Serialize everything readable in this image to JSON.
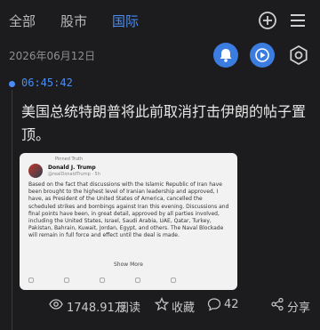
{
  "tabs": [
    {
      "label": "全部"
    },
    {
      "label": "股市"
    },
    {
      "label": "国际"
    }
  ],
  "active_tab": 2,
  "date": "2026年06月12日",
  "item": {
    "time": "06:45:42",
    "headline": "美国总统特朗普将此前取消打击伊朗的帖子置顶。",
    "embed": {
      "pinned_label": "Pinned Truth",
      "author_name": "Donald J. Trump",
      "author_handle": "@realDonaldTrump · 5h",
      "body": "Based on the fact that discussions with the Islamic Republic of Iran have been brought to the highest level of Iranian leadership and approved, I have, as President of the United States of America, cancelled the scheduled strikes and bombings against Iran this evening. Discussions and final points have been, in great detail, approved by all parties involved, including the United States, Israel, Saudi Arabia, UAE, Qatar, Turkey, Pakistan, Bahrain, Kuwait, Jordan, Egypt, and others. The Naval Blockade will remain in full force and effect until the deal is made.",
      "show_more": "Show More"
    },
    "stats": {
      "views": "1748.91万",
      "views_unit": "阅读",
      "favorite": "收藏",
      "comments": "42",
      "share": "分享"
    }
  },
  "colors": {
    "accent": "#4a8df5",
    "background": "#1c1c1e"
  },
  "icons": [
    "plus-circle-icon",
    "menu-icon",
    "bell-icon",
    "play-icon",
    "settings-icon",
    "eye-icon",
    "star-icon",
    "comment-icon",
    "share-icon"
  ]
}
